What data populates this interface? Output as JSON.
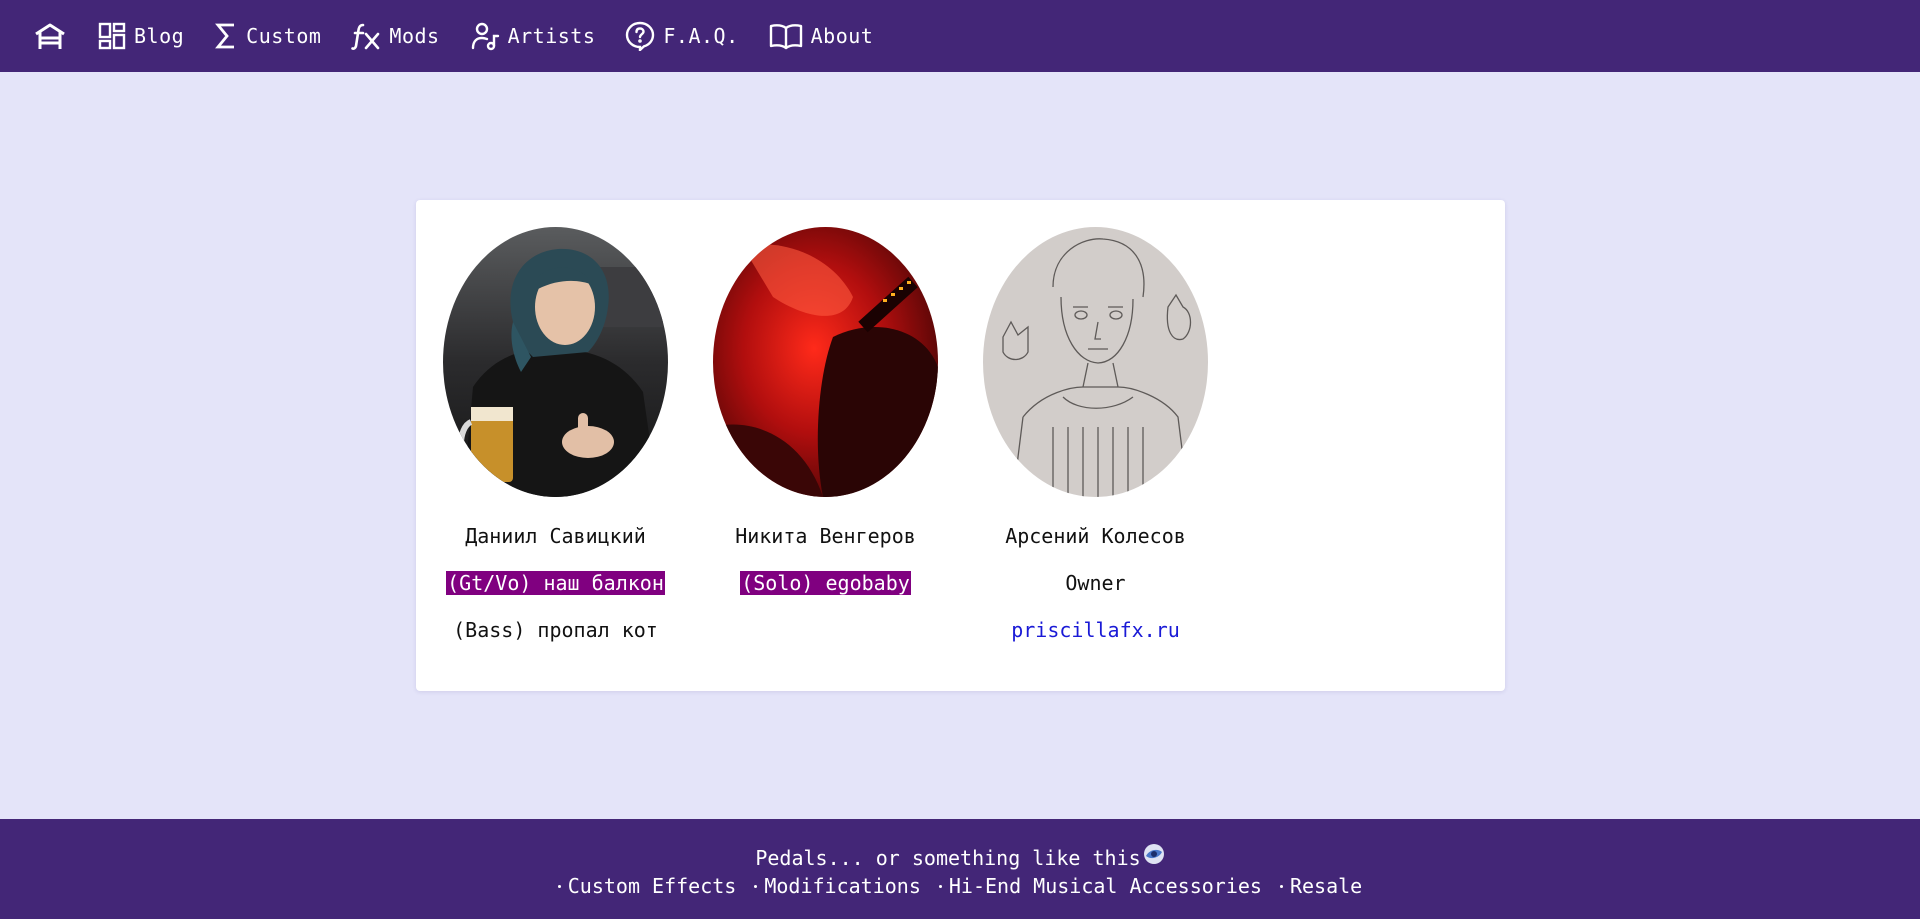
{
  "nav": {
    "home_icon": "home-icon",
    "items": [
      {
        "label": "Blog",
        "icon": "dashboard-icon"
      },
      {
        "label": "Custom",
        "icon": "sigma-icon"
      },
      {
        "label": "Mods",
        "icon": "fx-icon"
      },
      {
        "label": "Artists",
        "icon": "user-music-icon"
      },
      {
        "label": "F.A.Q.",
        "icon": "question-icon"
      },
      {
        "label": "About",
        "icon": "book-icon"
      }
    ]
  },
  "artists": [
    {
      "name": "Даниил Савицкий",
      "line1": "(Gt/Vo) наш балкон",
      "line2": "(Bass) пропал кот"
    },
    {
      "name": "Никита Венгеров",
      "line1": "(Solo) egobaby"
    },
    {
      "name": "Арсений Колесов",
      "line1": "Owner",
      "line2": "priscillafx.ru"
    }
  ],
  "footer": {
    "tagline": "Pedals... or something like this",
    "links": [
      "Custom Effects",
      "Modifications",
      "Hi-End Musical Accessories",
      "Resale"
    ]
  },
  "colors": {
    "nav_bg": "#432677",
    "page_bg": "#e4e4f9",
    "highlight_bg": "#800080",
    "link": "#1a1ad6"
  }
}
